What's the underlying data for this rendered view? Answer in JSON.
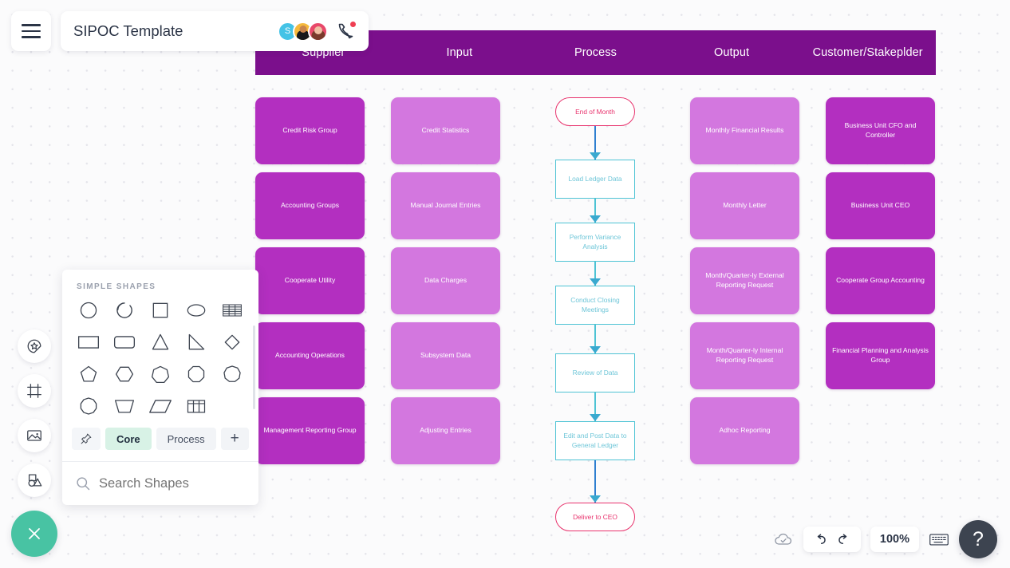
{
  "app": {
    "doc_title": "SIPOC Template",
    "menu_icon": "hamburger-icon",
    "call_icon": "phone-call-icon"
  },
  "collaborators": [
    {
      "initial": "S",
      "color": "#44c3e6"
    },
    {
      "initial": "",
      "color": "#f5b93c"
    },
    {
      "initial": "",
      "color": "#e8486a"
    }
  ],
  "band": {
    "color": "#7b0f8c",
    "columns": [
      "Supplier",
      "Input",
      "Process",
      "Output",
      "Customer/Stakeplder"
    ]
  },
  "colors": {
    "card_dark": "#b32fc0",
    "card_light": "#d377df",
    "terminator": "#e8336d",
    "process_box": "#4ec3d4",
    "accent_green": "#48c3a3",
    "band_purple": "#7b0f8c"
  },
  "columns": {
    "supplier": {
      "title": "Supplier",
      "tone": "dark",
      "cards": [
        "Credit Risk Group",
        "Accounting Groups",
        "Cooperate Utility",
        "Accounting Operations",
        "Management Reporting Group"
      ]
    },
    "input": {
      "title": "Input",
      "tone": "light",
      "cards": [
        "Credit Statistics",
        "Manual Journal Entries",
        "Data Charges",
        "Subsystem Data",
        "Adjusting Entries"
      ]
    },
    "output": {
      "title": "Output",
      "tone": "light",
      "cards": [
        "Monthly Financial Results",
        "Monthly Letter",
        "Month/Quarter-ly External Reporting Request",
        "Month/Quarter-ly Internal Reporting Request",
        "Adhoc Reporting"
      ]
    },
    "customer": {
      "title": "Customer/Stakeplder",
      "tone": "dark",
      "cards": [
        "Business Unit CFO and Controller",
        "Business Unit CEO",
        "Cooperate Group Accounting",
        "Financial Planning and Analysis Group"
      ]
    }
  },
  "process_flow": {
    "title": "Process",
    "nodes": [
      {
        "label": "End of Month",
        "shape": "terminator"
      },
      {
        "label": "Load Ledger Data",
        "shape": "process"
      },
      {
        "label": "Perform Variance Analysis",
        "shape": "process"
      },
      {
        "label": "Conduct Closing Meetings",
        "shape": "process"
      },
      {
        "label": "Review of Data",
        "shape": "process"
      },
      {
        "label": "Edit and Post Data to General Ledger",
        "shape": "process"
      },
      {
        "label": "Deliver to CEO",
        "shape": "terminator"
      }
    ]
  },
  "left_rail": [
    {
      "icon": "theme-sticker-icon",
      "name": "theme"
    },
    {
      "icon": "frame-icon",
      "name": "frame"
    },
    {
      "icon": "image-icon",
      "name": "image"
    },
    {
      "icon": "shapes-icon",
      "name": "shapes"
    }
  ],
  "shapes_panel": {
    "heading": "SIMPLE SHAPES",
    "shapes": [
      "circle",
      "arc",
      "square",
      "ellipse",
      "table-striped",
      "rectangle",
      "rounded-rectangle",
      "triangle",
      "right-triangle",
      "diamond",
      "pentagon",
      "hexagon",
      "heptagon",
      "octagon",
      "nonagon",
      "decagon",
      "trapezoid",
      "parallelogram",
      "table-grid"
    ],
    "tabs": [
      {
        "label": "",
        "icon": "pin-icon",
        "active": false
      },
      {
        "label": "Core",
        "active": true
      },
      {
        "label": "Process",
        "active": false
      },
      {
        "label": "+",
        "active": false
      }
    ],
    "search_placeholder": "Search Shapes",
    "search_value": "",
    "more_icon": "kebab-menu-icon"
  },
  "bottom_bar": {
    "save_icon": "cloud-saved-icon",
    "undo_icon": "undo-icon",
    "redo_icon": "redo-icon",
    "zoom_level": "100%",
    "keyboard_icon": "keyboard-icon",
    "help_label": "?"
  },
  "close_fab": {
    "icon": "close-icon"
  }
}
